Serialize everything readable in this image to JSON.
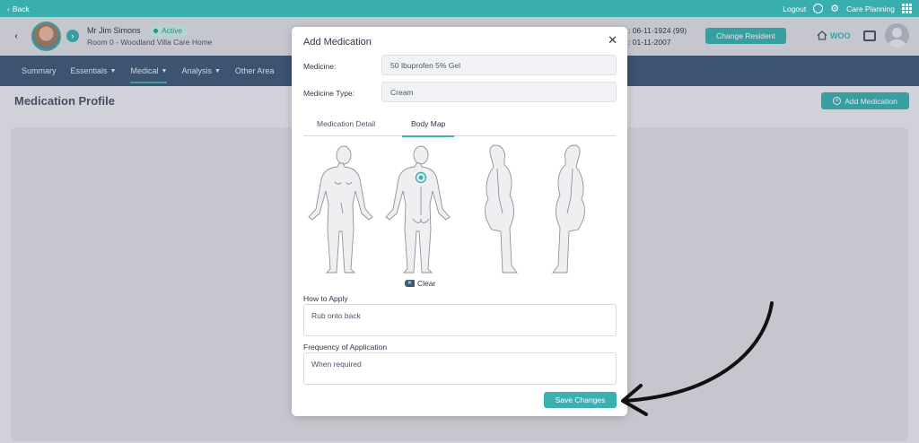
{
  "topbar": {
    "back_label": "Back",
    "logout_label": "Logout",
    "care_planning_label": "Care Planning"
  },
  "resident": {
    "name": "Mr Jim Simons",
    "status": "Active",
    "room": "Room 0 - Woodland Villa Care Home",
    "dob_line": ": 06-11-1924 (99)",
    "admitted_line": ": 01-11-2007",
    "change_button": "Change Resident",
    "home_code": "WOO"
  },
  "nav": {
    "items": [
      {
        "label": "Summary",
        "dropdown": false
      },
      {
        "label": "Essentials",
        "dropdown": true
      },
      {
        "label": "Medical",
        "dropdown": true,
        "active": true
      },
      {
        "label": "Analysis",
        "dropdown": true
      },
      {
        "label": "Other Area",
        "dropdown": false
      }
    ]
  },
  "page": {
    "title": "Medication Profile",
    "add_button": "Add Medication"
  },
  "modal": {
    "title": "Add Medication",
    "medicine_label": "Medicine:",
    "medicine_value": "50 Ibuprofen 5% Gel",
    "type_label": "Medicine Type:",
    "type_value": "Cream",
    "tabs": [
      "Medication Detail",
      "Body Map"
    ],
    "active_tab": "Body Map",
    "clear_label": "Clear",
    "how_label": "How to Apply",
    "how_value": "Rub onto back",
    "freq_label": "Frequency of Application",
    "freq_value": "When required",
    "save_button": "Save Changes"
  },
  "colors": {
    "accent": "#3bb0b0",
    "nav_bg": "#3f5b78",
    "active_badge_bg": "#c9ebe6"
  }
}
